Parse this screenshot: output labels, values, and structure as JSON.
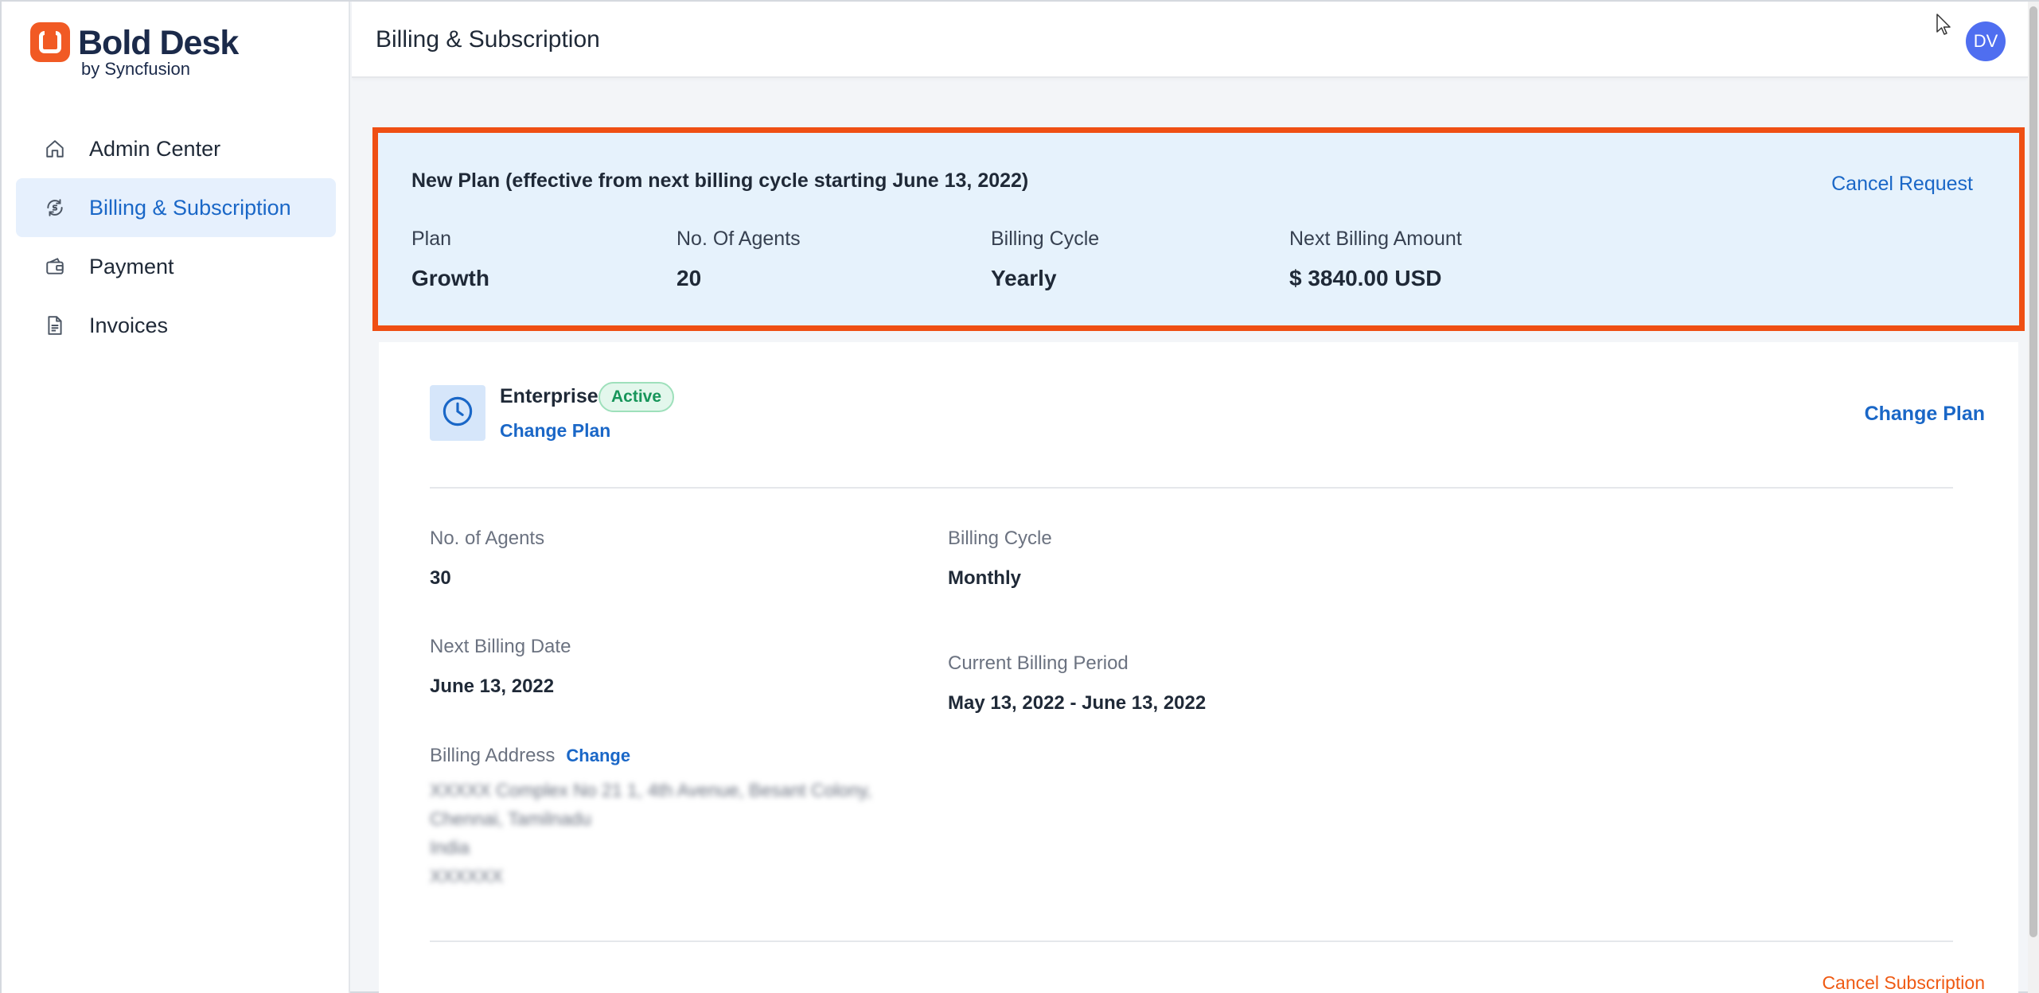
{
  "brand": {
    "name": "Bold Desk",
    "by": "by Syncfusion",
    "accent": "#f15a24"
  },
  "sidebar": {
    "items": [
      {
        "label": "Admin Center",
        "icon": "home-icon",
        "active": false
      },
      {
        "label": "Billing & Subscription",
        "icon": "billing-icon",
        "active": true
      },
      {
        "label": "Payment",
        "icon": "wallet-icon",
        "active": false
      },
      {
        "label": "Invoices",
        "icon": "document-icon",
        "active": false
      }
    ]
  },
  "header": {
    "title": "Billing & Subscription",
    "avatar_initials": "DV"
  },
  "new_plan": {
    "title": "New Plan (effective from next billing cycle starting June 13, 2022)",
    "cancel_request": "Cancel Request",
    "highlight_color": "#ef4f13",
    "fields": [
      {
        "label": "Plan",
        "value": "Growth"
      },
      {
        "label": "No. Of Agents",
        "value": "20"
      },
      {
        "label": "Billing Cycle",
        "value": "Yearly"
      },
      {
        "label": "Next Billing Amount",
        "value": "$ 3840.00 USD"
      }
    ]
  },
  "current_plan": {
    "name": "Enterprise",
    "status": "Active",
    "change_plan": "Change Plan",
    "change_plan_right": "Change Plan",
    "agents_label": "No. of Agents",
    "agents_value": "30",
    "cycle_label": "Billing Cycle",
    "cycle_value": "Monthly",
    "next_date_label": "Next Billing Date",
    "next_date_value": "June 13, 2022",
    "period_label": "Current Billing Period",
    "period_value": "May 13, 2022 - June 13, 2022",
    "address_label": "Billing Address",
    "address_change": "Change",
    "address_lines": [
      "XXXXX Complex No 21 1, 4th Avenue, Besant Colony,",
      "Chennai, Tamilnadu",
      "India",
      "XXXXXX"
    ],
    "cancel_subscription": "Cancel Subscription"
  }
}
